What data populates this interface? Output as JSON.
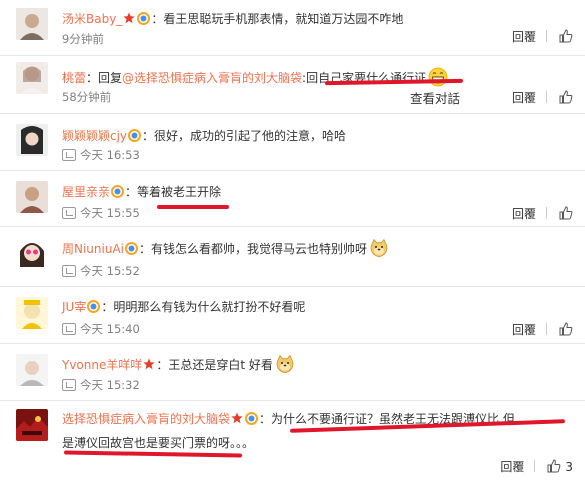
{
  "colors": {
    "username": "#eb7350",
    "meta": "#808080",
    "underline": "#e0172b",
    "badge_red": "#e63b28"
  },
  "actions": {
    "reply_label": "回覆",
    "like_icon": "thumbs-up-icon"
  },
  "comments": [
    {
      "user": "汤米Baby_",
      "badges": [
        "star",
        "rainbow"
      ],
      "text": "：看王思聪玩手机那表情，就知道万达园不咋地",
      "time": "9分钟前",
      "like": ""
    },
    {
      "user": "桃蕾",
      "badges": [],
      "reply_prefix": "：回复",
      "reply_to": "@选择恐惧症病入膏肓的刘大脑袋",
      "text": ":回自己家要什么通行证",
      "time": "58分钟前",
      "overlay": "查看对話",
      "like": "",
      "emoji": "grin"
    },
    {
      "user": "颖颖颖颖cjy",
      "badges": [
        "rainbow"
      ],
      "text": "：很好，成功的引起了他的注意，哈哈",
      "time": "今天 16:53",
      "like": ""
    },
    {
      "user": "屋里亲亲",
      "badges": [
        "rainbow"
      ],
      "text": "：等着被老王开除",
      "time": "今天 15:55",
      "like": ""
    },
    {
      "user": "周NiuniuAi",
      "badges": [
        "rainbow"
      ],
      "text": "：有钱怎么看都帅，我觉得马云也特别帅呀",
      "time": "今天 15:52",
      "like": "",
      "emoji": "doge"
    },
    {
      "user": "JU宰",
      "badges": [
        "rainbow"
      ],
      "text": "：明明那么有钱为什么就打扮不好看呢",
      "time": "今天 15:40",
      "like": ""
    },
    {
      "user": "Yvonne羊咩咩",
      "badges": [
        "star"
      ],
      "text": "：王总还是穿白t 好看",
      "time": "今天 15:32",
      "like": "",
      "emoji": "doge"
    },
    {
      "user": "选择恐惧症病入膏肓的刘大脑袋",
      "badges": [
        "star",
        "rainbow"
      ],
      "text": "：为什么不要通行证？虽然老王无法跟溥仪比 但",
      "text2": "是溥仪回故宫也是要买门票的呀。。。",
      "time": "",
      "like": "3"
    }
  ]
}
